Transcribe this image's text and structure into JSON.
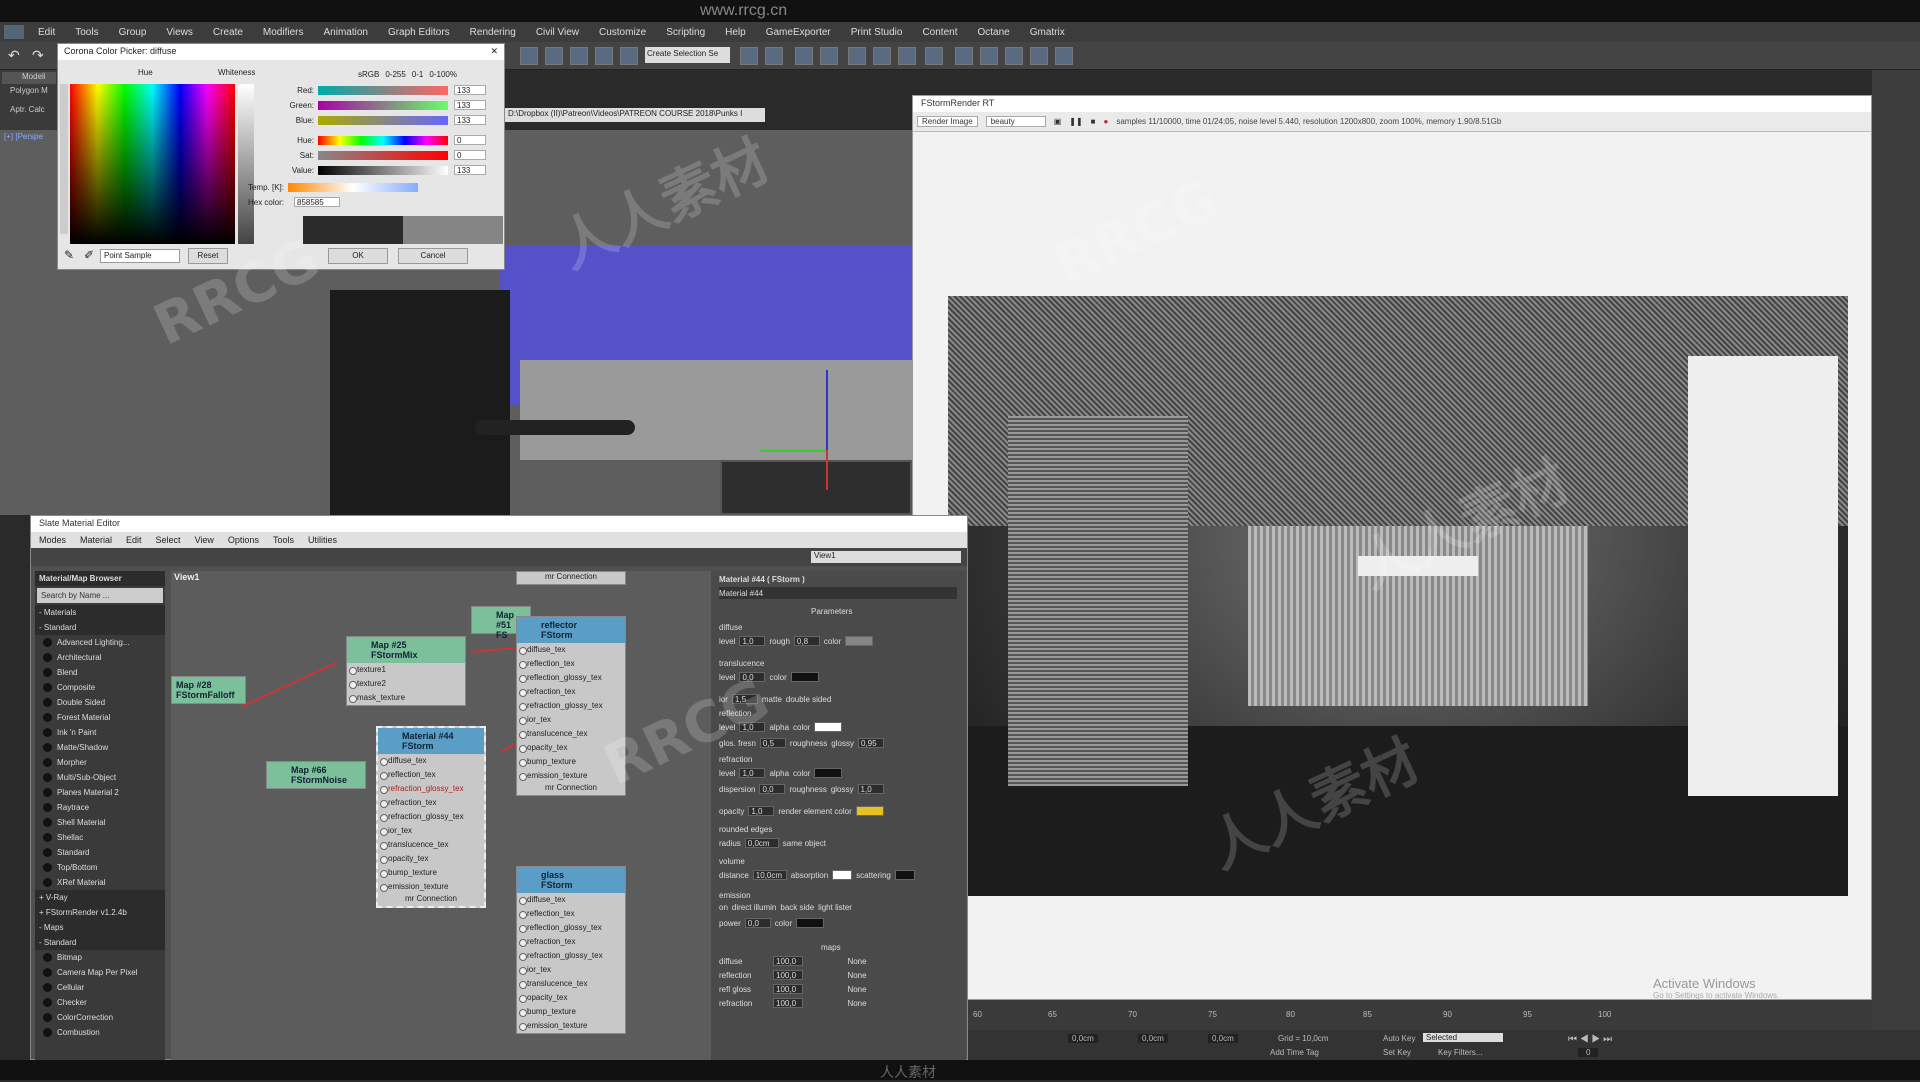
{
  "menubar": {
    "items": [
      "Edit",
      "Tools",
      "Group",
      "Views",
      "Create",
      "Modifiers",
      "Animation",
      "Graph Editors",
      "Rendering",
      "Civil View",
      "Customize",
      "Scripting",
      "Help",
      "GameExporter",
      "Print Studio",
      "Content",
      "Octane",
      "Gmatrix"
    ]
  },
  "top_url_watermark": "www.rrcg.cn",
  "toolbar": {
    "selection_set": "Create Selection Se",
    "path_field": "D:\\Dropbox (II)\\Patreon\\Videos\\PATREON COURSE 2018\\Punks I"
  },
  "left": {
    "tab_modeling": "Modeli",
    "tab_polygon": "Polygon M",
    "tab_calc": "Aptr. Calc",
    "viewport_label": "[+] [Perspe"
  },
  "color_picker": {
    "title": "Corona Color Picker: diffuse",
    "hue_label": "Hue",
    "whiteness_label": "Whiteness",
    "srgb": "sRGB",
    "opt1": "0-255",
    "opt2": "0-1",
    "opt3": "0-100%",
    "red_label": "Red:",
    "red": "133",
    "green_label": "Green:",
    "green": "133",
    "blue_label": "Blue:",
    "blue": "133",
    "hue2_label": "Hue:",
    "hue": "0",
    "sat_label": "Sat:",
    "sat": "0",
    "value_label": "Value:",
    "value": "133",
    "temp_label": "Temp. [K]:",
    "hex_label": "Hex color:",
    "hex": "858585",
    "sample_mode": "Point Sample",
    "reset": "Reset",
    "ok": "OK",
    "cancel": "Cancel",
    "colors": {
      "old": "#2b2b2b",
      "new": "#858585"
    }
  },
  "render": {
    "title": "FStormRender RT",
    "mode": "Render Image",
    "pass": "beauty",
    "stats": "samples 11/10000, time 01/24:05, noise level 5.440, resolution 1200x800, zoom 100%, memory 1.90/8.51Gb",
    "activate1": "Activate Windows",
    "activate2": "Go to Settings to activate Windows."
  },
  "sme": {
    "title": "Slate Material Editor",
    "menu": [
      "Modes",
      "Material",
      "Edit",
      "Select",
      "View",
      "Options",
      "Tools",
      "Utilities"
    ],
    "view_select": "View1",
    "browser_title": "Material/Map Browser",
    "search": "Search by Name ...",
    "view_tab": "View1",
    "materials_cat": "- Materials",
    "standard_cat": "- Standard",
    "materials": [
      "Advanced Lighting...",
      "Architectural",
      "Blend",
      "Composite",
      "Double Sided",
      "Forest Material",
      "Ink 'n Paint",
      "Matte/Shadow",
      "Morpher",
      "Multi/Sub-Object",
      "Planes Material 2",
      "Raytrace",
      "Shell Material",
      "Shellac",
      "Standard",
      "Top/Bottom",
      "XRef Material"
    ],
    "vray_cat": "+ V-Ray",
    "fstorm_cat": "+ FStormRender v1.2.4b",
    "maps_cat": "- Maps",
    "maps_standard": "- Standard",
    "maps": [
      "Bitmap",
      "Camera Map Per Pixel",
      "Cellular",
      "Checker",
      "ColorCorrection",
      "Combustion"
    ],
    "nodes": {
      "map25": {
        "title1": "Map #25",
        "title2": "FStormMix",
        "slots": [
          "texture1",
          "texture2",
          "mask_texture"
        ]
      },
      "map28": {
        "title1": "Map #28",
        "title2": "FStormFalloff"
      },
      "map66": {
        "title1": "Map #66",
        "title2": "FStormNoise"
      },
      "mat44": {
        "title1": "Material #44",
        "title2": "FStorm",
        "slots": [
          "diffuse_tex",
          "reflection_tex",
          "refraction_glossy_tex",
          "refraction_tex",
          "refraction_glossy_tex",
          "ior_tex",
          "translucence_tex",
          "opacity_tex",
          "bump_texture",
          "emission_texture"
        ],
        "footer": "mr Connection"
      },
      "reflector": {
        "title1": "reflector",
        "title2": "FStorm",
        "slots": [
          "diffuse_tex",
          "reflection_tex",
          "reflection_glossy_tex",
          "refraction_tex",
          "refraction_glossy_tex",
          "ior_tex",
          "translucence_tex",
          "opacity_tex",
          "bump_texture",
          "emission_texture"
        ],
        "footer": "mr Connection",
        "header_conn": "mr Connection"
      },
      "glass": {
        "title1": "glass",
        "title2": "FStorm",
        "slots": [
          "diffuse_tex",
          "reflection_tex",
          "reflection_glossy_tex",
          "refraction_tex",
          "refraction_glossy_tex",
          "ior_tex",
          "translucence_tex",
          "opacity_tex",
          "bump_texture",
          "emission_texture"
        ]
      },
      "map51": {
        "title1": "Map #51",
        "title2": "FS"
      }
    },
    "props": {
      "title": "Material #44 ( FStorm )",
      "name": "Material #44",
      "params": "Parameters",
      "diffuse": "diffuse",
      "level": "level",
      "diffuse_level": "1,0",
      "rough": "rough",
      "rough_val": "0,8",
      "color": "color",
      "translucence": "translucence",
      "trans_level": "0,0",
      "ior": "ior",
      "ior_val": "1,5",
      "matte": "matte",
      "double_sided": "double sided",
      "reflection": "reflection",
      "refl_level": "1,0",
      "alpha": "alpha",
      "glos_fresn": "glos. fresn",
      "glos_val": "0,5",
      "roughness": "roughness",
      "glossy": "glossy",
      "glossy_val": "0,95",
      "refraction": "refraction",
      "refr_level": "1,0",
      "dispersion": "dispersion",
      "disp_val": "0,0",
      "refr_glossy": "1,0",
      "opacity": "opacity",
      "opacity_val": "1,0",
      "render_element_color": "render element color",
      "rounded_edges": "rounded edges",
      "radius": "radius",
      "radius_val": "0,0cm",
      "same_object": "same object",
      "volume": "volume",
      "distance": "distance",
      "distance_val": "10,0cm",
      "absorption": "absorption",
      "scattering": "scattering",
      "emission": "emission",
      "on": "on",
      "direct_illum": "direct illumin",
      "back_side": "back side",
      "light_lister": "light lister",
      "power": "power",
      "power_val": "0,0",
      "maps": "maps",
      "map_rows": [
        {
          "name": "diffuse",
          "val": "100,0",
          "map": "None"
        },
        {
          "name": "reflection",
          "val": "100,0",
          "map": "None"
        },
        {
          "name": "refl gloss",
          "val": "100,0",
          "map": "None"
        },
        {
          "name": "refraction",
          "val": "100,0",
          "map": "None"
        }
      ]
    }
  },
  "timeline": {
    "ticks": [
      "60",
      "65",
      "70",
      "75",
      "80",
      "85",
      "90",
      "95",
      "100"
    ]
  },
  "status": {
    "x": "0,0cm",
    "y": "0,0cm",
    "z": "0,0cm",
    "grid": "Grid = 10,0cm",
    "auto_key": "Auto Key",
    "selected": "Selected",
    "set_key": "Set Key",
    "key_filters": "Key Filters...",
    "add_time_tag": "Add Time Tag",
    "frame": "0"
  },
  "watermarks": {
    "rrcg": "RRCG",
    "cn": "人人素材",
    "bottom_logo": "人人素材"
  },
  "accent": {
    "node_green": "#7cbf9b",
    "node_blue": "#5a9ec8",
    "wire": "#cc3333",
    "opacity_swatch": "#e8c020"
  }
}
